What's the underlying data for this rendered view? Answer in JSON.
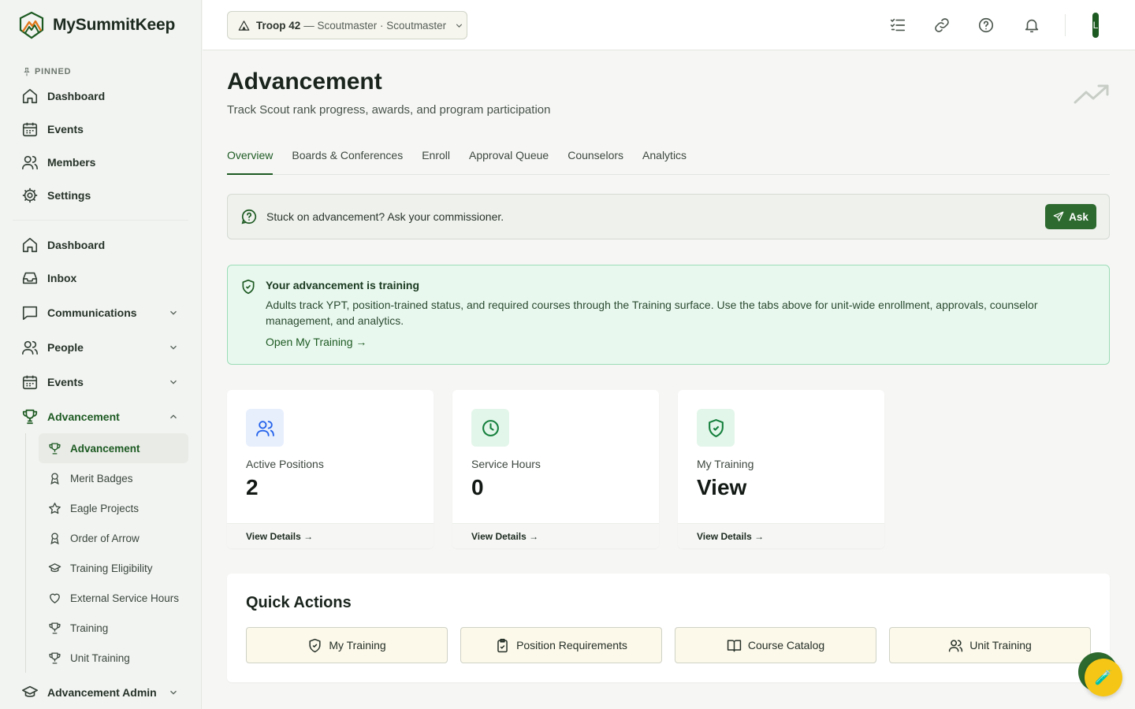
{
  "brand": {
    "name": "MySummitKeep"
  },
  "sidebar": {
    "pinned_label": "PINNED",
    "pinned": [
      {
        "label": "Dashboard",
        "icon": "home-icon"
      },
      {
        "label": "Events",
        "icon": "calendar-icon"
      },
      {
        "label": "Members",
        "icon": "users-icon"
      },
      {
        "label": "Settings",
        "icon": "gear-icon"
      }
    ],
    "nav": [
      {
        "label": "Dashboard",
        "icon": "home-icon"
      },
      {
        "label": "Inbox",
        "icon": "inbox-icon"
      },
      {
        "label": "Communications",
        "icon": "message-icon"
      },
      {
        "label": "People",
        "icon": "users-icon"
      },
      {
        "label": "Events",
        "icon": "calendar-icon"
      },
      {
        "label": "Advancement",
        "icon": "trophy-icon"
      }
    ],
    "advancement_sub": [
      {
        "label": "Advancement",
        "icon": "trophy-icon"
      },
      {
        "label": "Merit Badges",
        "icon": "award-icon"
      },
      {
        "label": "Eagle Projects",
        "icon": "star-icon"
      },
      {
        "label": "Order of Arrow",
        "icon": "award-icon"
      },
      {
        "label": "Training Eligibility",
        "icon": "graduation-cap-icon"
      },
      {
        "label": "External Service Hours",
        "icon": "heart-icon"
      },
      {
        "label": "Training",
        "icon": "trophy-icon"
      },
      {
        "label": "Unit Training",
        "icon": "trophy-icon"
      }
    ],
    "admin": {
      "label": "Advancement Admin",
      "icon": "graduation-cap-icon"
    }
  },
  "topbar": {
    "unit_name": "Troop 42",
    "unit_role": "— Scoutmaster · Scoutmaster",
    "avatar_initial": "L"
  },
  "page": {
    "title": "Advancement",
    "subtitle": "Track Scout rank progress, awards, and program participation",
    "tabs": [
      "Overview",
      "Boards & Conferences",
      "Enroll",
      "Approval Queue",
      "Counselors",
      "Analytics"
    ],
    "active_tab": "Overview"
  },
  "help_banner": {
    "text": "Stuck on advancement? Ask your commissioner.",
    "button": "Ask"
  },
  "info_card": {
    "title": "Your advancement is training",
    "body": "Adults track YPT, position-trained status, and required courses through the Training surface. Use the tabs above for unit-wide enrollment, approvals, counselor management, and analytics.",
    "link": "Open My Training →"
  },
  "stats": [
    {
      "label": "Active Positions",
      "value": "2",
      "footer": "View Details →",
      "icon": "users-icon",
      "color": "#2563eb",
      "bg": "#e7effd"
    },
    {
      "label": "Service Hours",
      "value": "0",
      "footer": "View Details →",
      "icon": "clock-icon",
      "color": "#15803d",
      "bg": "#e3f6ea"
    },
    {
      "label": "My Training",
      "value": "View",
      "footer": "View Details →",
      "icon": "shield-check-icon",
      "color": "#15803d",
      "bg": "#e3f6ea"
    }
  ],
  "quick_actions": {
    "title": "Quick Actions",
    "items": [
      {
        "label": "My Training",
        "icon": "shield-check-icon"
      },
      {
        "label": "Position Requirements",
        "icon": "clipboard-check-icon"
      },
      {
        "label": "Course Catalog",
        "icon": "book-open-icon"
      },
      {
        "label": "Unit Training",
        "icon": "users-icon"
      }
    ]
  },
  "colors": {
    "brand_green": "#1d5a22",
    "button_green": "#2d6a2f",
    "fab_yellow": "#f6c616"
  }
}
